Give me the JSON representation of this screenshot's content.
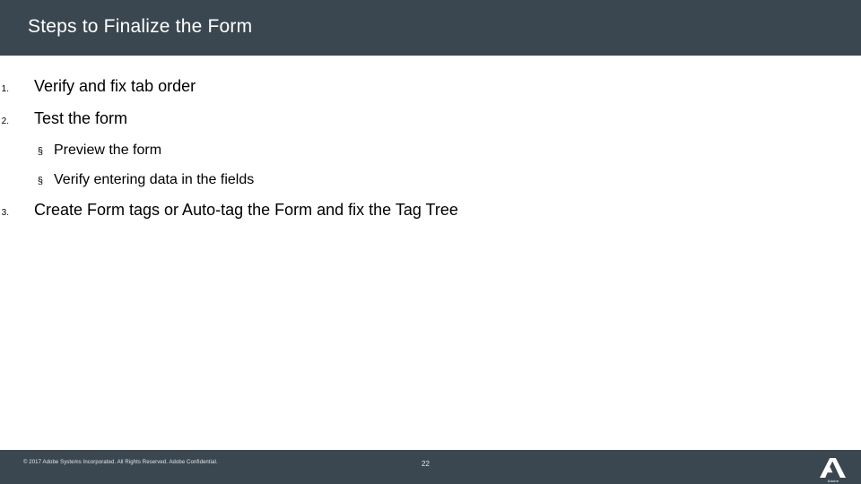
{
  "header": {
    "title": "Steps to Finalize the Form"
  },
  "body": {
    "steps": [
      {
        "number": "1.",
        "text": "Verify and fix tab order",
        "subs": []
      },
      {
        "number": "2.",
        "text": "Test the form",
        "subs": [
          {
            "bullet": "§",
            "text": "Preview the form"
          },
          {
            "bullet": "§",
            "text": "Verify entering data in the fields"
          }
        ]
      },
      {
        "number": "3.",
        "text": "Create Form tags or Auto-tag the Form and fix the Tag Tree",
        "subs": []
      }
    ]
  },
  "footer": {
    "copyright": "© 2017 Adobe Systems Incorporated.  All Rights Reserved.  Adobe Confidential.",
    "page_number": "22",
    "logo_name": "adobe-logo",
    "logo_label": "Adobe"
  },
  "colors": {
    "header_bg": "#3b4750",
    "footer_bg": "#3b4750",
    "body_bg": "#ffffff",
    "text": "#000000",
    "header_text": "#ffffff"
  }
}
